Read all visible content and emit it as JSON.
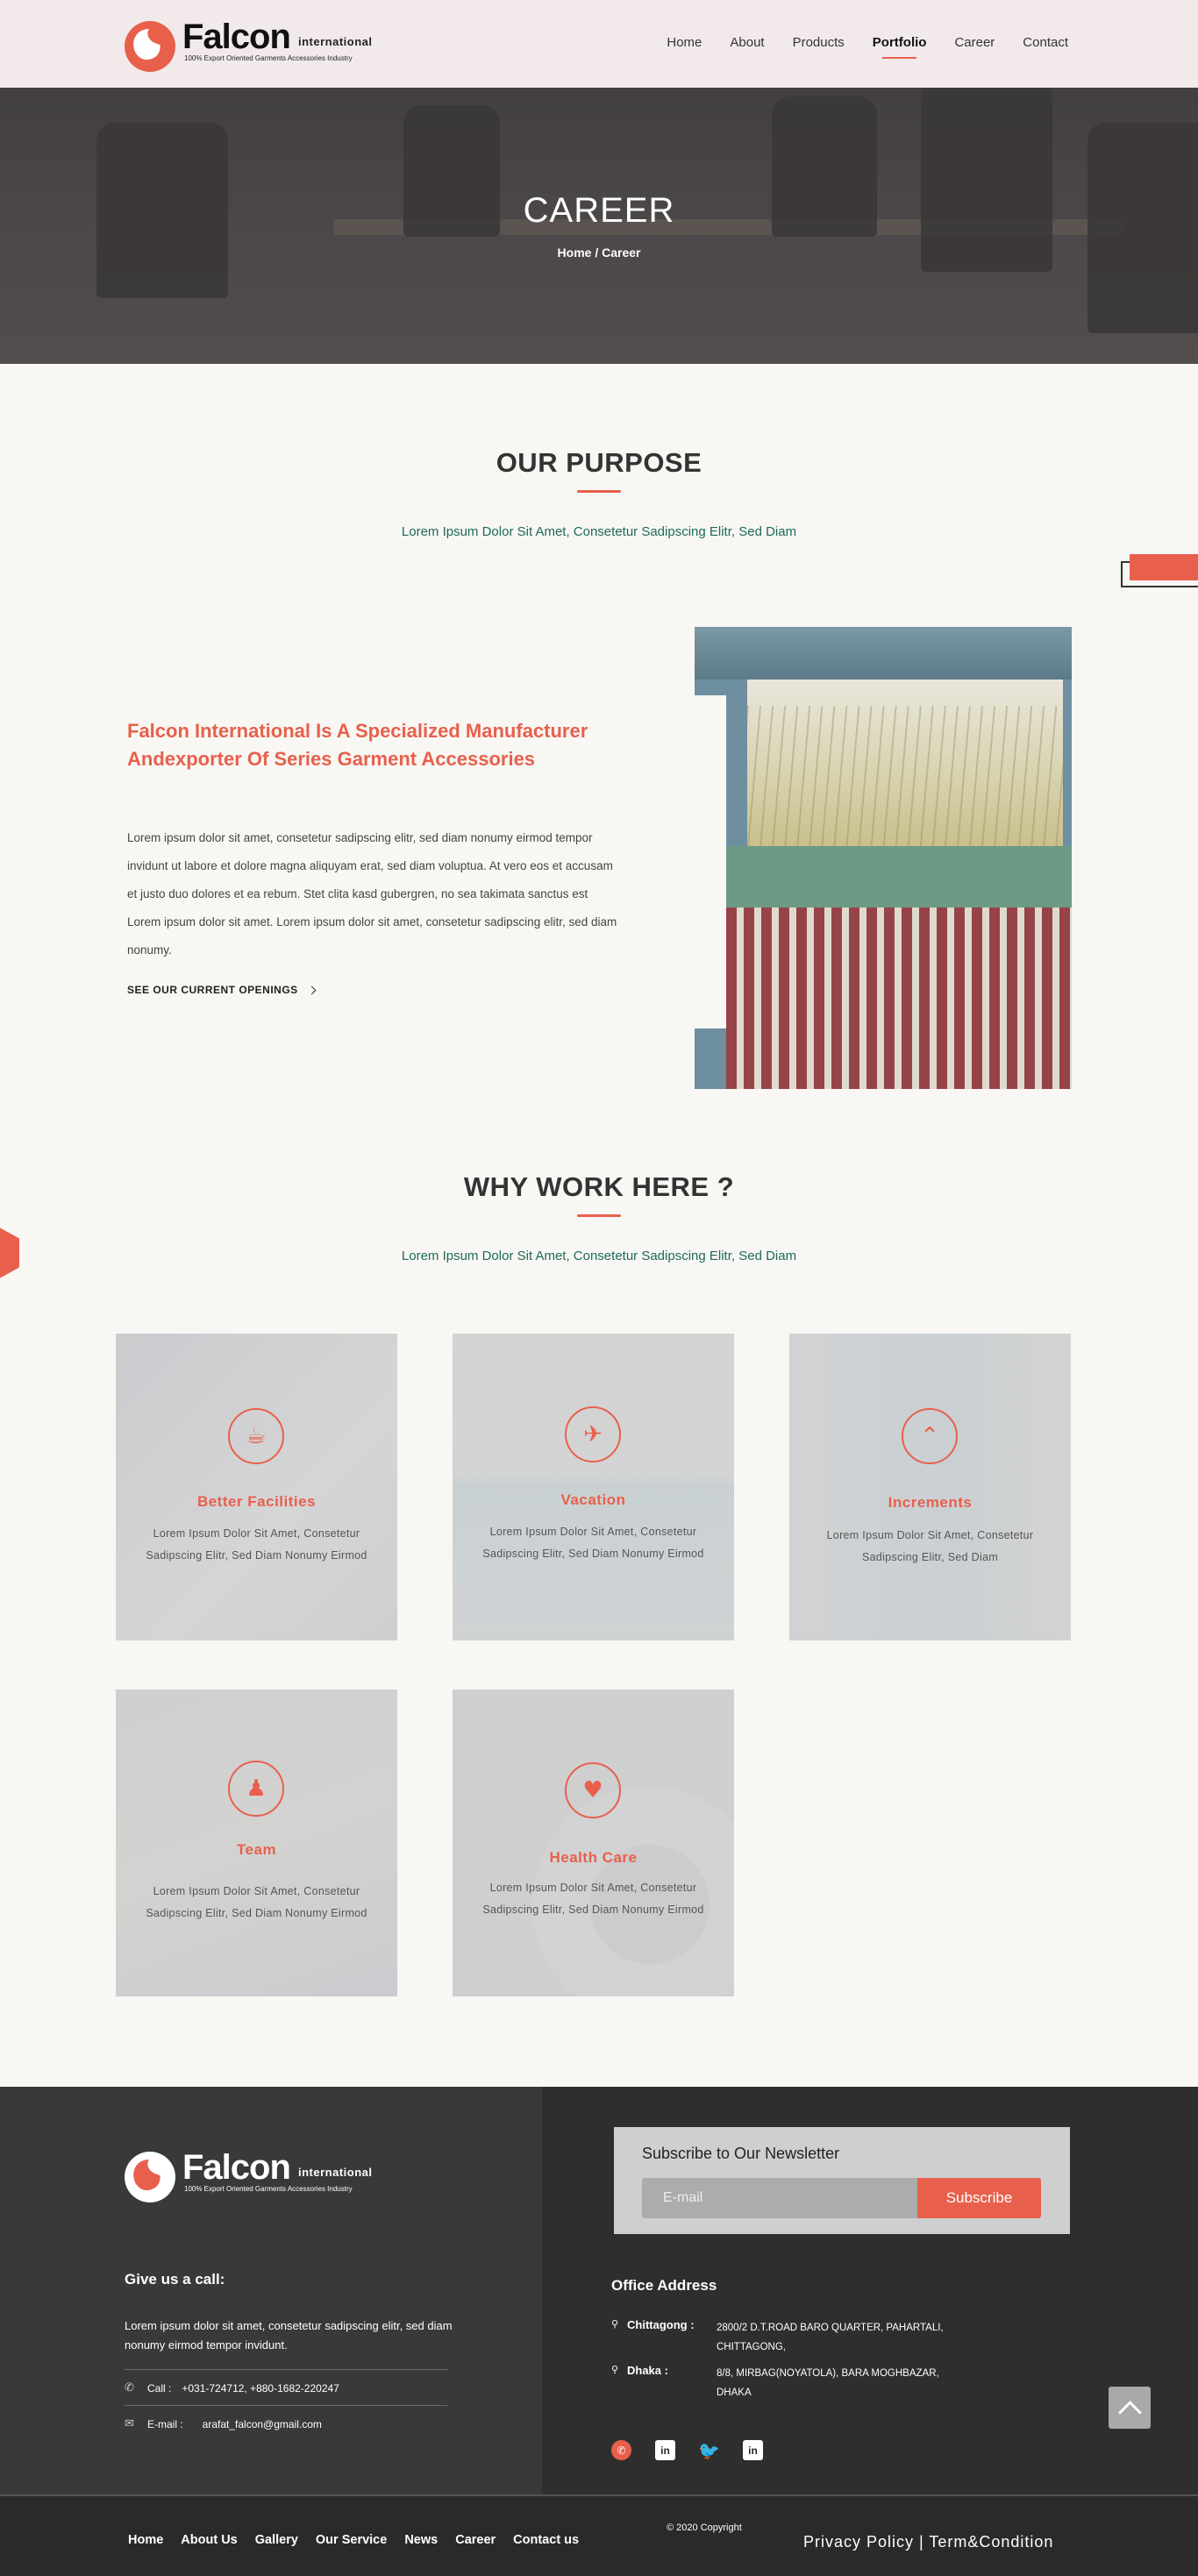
{
  "header": {
    "logo": {
      "name": "Falc",
      "name_o": "o",
      "name_end": "n",
      "suffix": "international",
      "tagline": "100% Export Oriented Garments Accessories Industry"
    },
    "nav": [
      "Home",
      "About",
      "Products",
      "Portfolio",
      "Career",
      "Contact"
    ],
    "active_nav": "Portfolio"
  },
  "hero": {
    "title": "CAREER",
    "breadcrumb": "Home / Career"
  },
  "purpose": {
    "title": "OUR PURPOSE",
    "subtitle": "Lorem Ipsum Dolor Sit Amet, Consetetur Sadipscing Elitr, Sed Diam",
    "heading": "Falcon International Is A Specialized Manufacturer Andexporter Of Series Garment Accessories",
    "body": "Lorem ipsum dolor sit amet, consetetur sadipscing elitr, sed diam nonumy eirmod tempor invidunt ut labore et dolore magna aliquyam erat, sed diam voluptua. At vero eos et accusam et justo duo dolores et ea rebum. Stet clita kasd gubergren, no sea takimata sanctus est Lorem ipsum dolor sit amet. Lorem ipsum dolor sit amet, consetetur sadipscing elitr, sed diam nonumy.",
    "link": "SEE OUR CURRENT OPENINGS"
  },
  "why": {
    "title": "WHY WORK HERE ?",
    "subtitle": "Lorem Ipsum Dolor Sit Amet, Consetetur Sadipscing Elitr, Sed Diam",
    "cards": [
      {
        "title": "Better Facilities",
        "text": "Lorem Ipsum Dolor Sit Amet, Consetetur Sadipscing Elitr, Sed Diam Nonumy Eirmod",
        "icon": "coffee-icon",
        "glyph": "☕"
      },
      {
        "title": "Vacation",
        "text": "Lorem Ipsum Dolor Sit Amet, Consetetur Sadipscing Elitr, Sed Diam Nonumy Eirmod",
        "icon": "vacation-icon",
        "glyph": "✈"
      },
      {
        "title": "Increments",
        "text": "Lorem Ipsum Dolor Sit Amet, Consetetur Sadipscing Elitr, Sed Diam",
        "icon": "double-chevron-up-icon",
        "glyph": "⌃"
      },
      {
        "title": "Team",
        "text": "Lorem Ipsum Dolor Sit Amet, Consetetur Sadipscing Elitr, Sed Diam Nonumy Eirmod",
        "icon": "team-icon",
        "glyph": "♟"
      },
      {
        "title": "Health Care",
        "text": "Lorem Ipsum Dolor Sit Amet, Consetetur Sadipscing Elitr, Sed Diam Nonumy Eirmod",
        "icon": "health-heart-icon",
        "glyph": "♥"
      }
    ]
  },
  "footer": {
    "call_title": "Give us a call:",
    "description": "Lorem ipsum dolor sit amet, consetetur sadipscing elitr, sed diam nonumy eirmod tempor invidunt.",
    "call_label": "Call :",
    "call_value": "+031-724712, +880-1682-220247",
    "email_label": "E-mail :",
    "email_value": "arafat_falcon@gmail.com",
    "newsletter_title": "Subscribe to Our Newsletter",
    "newsletter_placeholder": "E-mail",
    "newsletter_button": "Subscribe",
    "office_title": "Office Address",
    "offices": [
      {
        "city": "Chittagong :",
        "address": "2800/2 D.T.ROAD BARO QUARTER, PAHARTALI, CHITTAGONG,"
      },
      {
        "city": "Dhaka :",
        "address": "8/8, MIRBAG(NOYATOLA), BARA MOGHBAZAR, DHAKA"
      }
    ],
    "social_icons": [
      "whatsapp-icon",
      "linkedin-icon",
      "twitter-icon",
      "linkedin-icon"
    ],
    "bottom_nav": [
      "Home",
      "About Us",
      "Gallery",
      "Our Service",
      "News",
      "Career",
      "Contact us"
    ],
    "copyright": "© 2020 Copyright",
    "policy": "Privacy Policy | Term&Condition"
  },
  "colors": {
    "accent": "#e8604c",
    "footer_dark": "#2e2e2f",
    "footer_left": "#3a393a",
    "subtitle_green": "#1e6a5a"
  }
}
